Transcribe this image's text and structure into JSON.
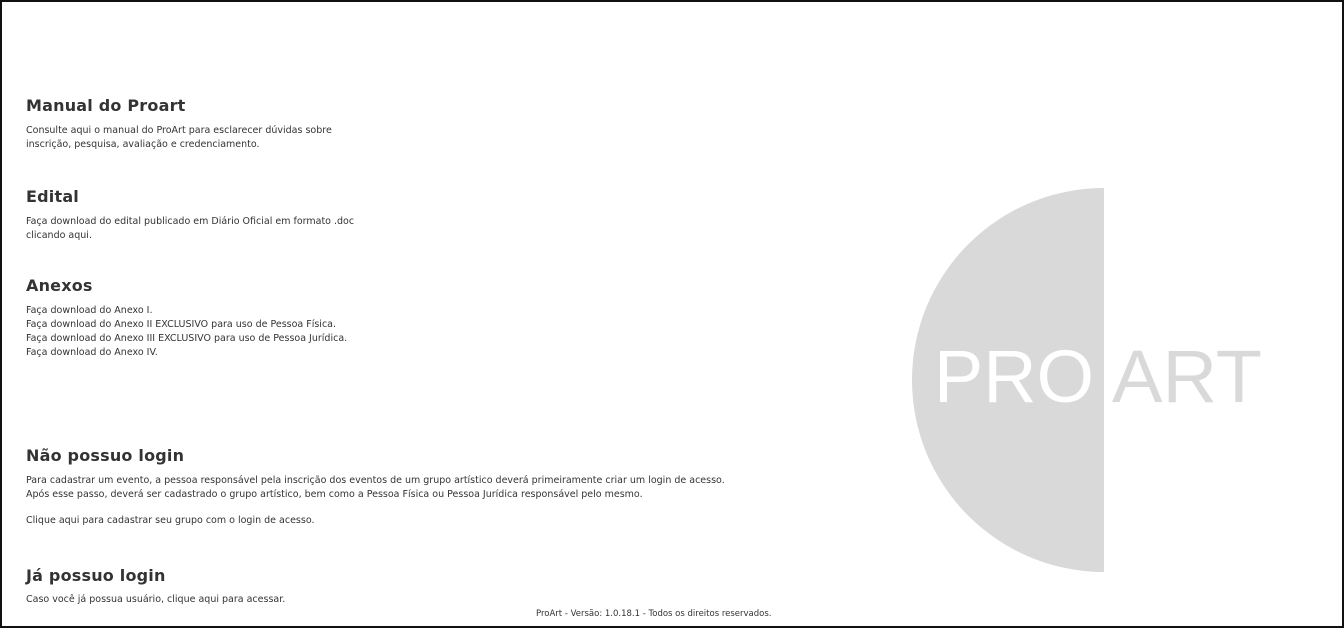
{
  "manual": {
    "title": "Manual do Proart",
    "text_line1": "Consulte aqui o manual do ProArt para esclarecer dúvidas sobre",
    "text_line2": "inscrição, pesquisa, avaliação e credenciamento."
  },
  "edital": {
    "title": "Edital",
    "text_line1": "Faça download do edital publicado em Diário Oficial em formato .doc",
    "text_line2": "clicando aqui."
  },
  "anexos": {
    "title": "Anexos",
    "items": [
      "Faça download do Anexo I.",
      "Faça download do Anexo II EXCLUSIVO para uso de Pessoa Física.",
      "Faça download do Anexo III EXCLUSIVO para uso de Pessoa Jurídica.",
      "Faça download do Anexo IV."
    ]
  },
  "sem_login": {
    "title": "Não possuo login",
    "text_line1": "Para cadastrar um evento, a pessoa responsável pela inscrição dos eventos de um grupo artístico deverá primeiramente criar um login de acesso.",
    "text_line2": "Após esse passo, deverá ser cadastrado o grupo artístico, bem como a Pessoa Física ou Pessoa Jurídica responsável pelo mesmo.",
    "cta": "Clique aqui para cadastrar seu grupo com o login de acesso."
  },
  "com_login": {
    "title": "Já possuo login",
    "text": "Caso você já possua usuário, clique aqui para acessar."
  },
  "logo": {
    "pro": "PRO",
    "art": "ART",
    "color": "#d9d9d9"
  },
  "footer": {
    "text": "ProArt - Versão: 1.0.18.1 - Todos os direitos reservados."
  }
}
